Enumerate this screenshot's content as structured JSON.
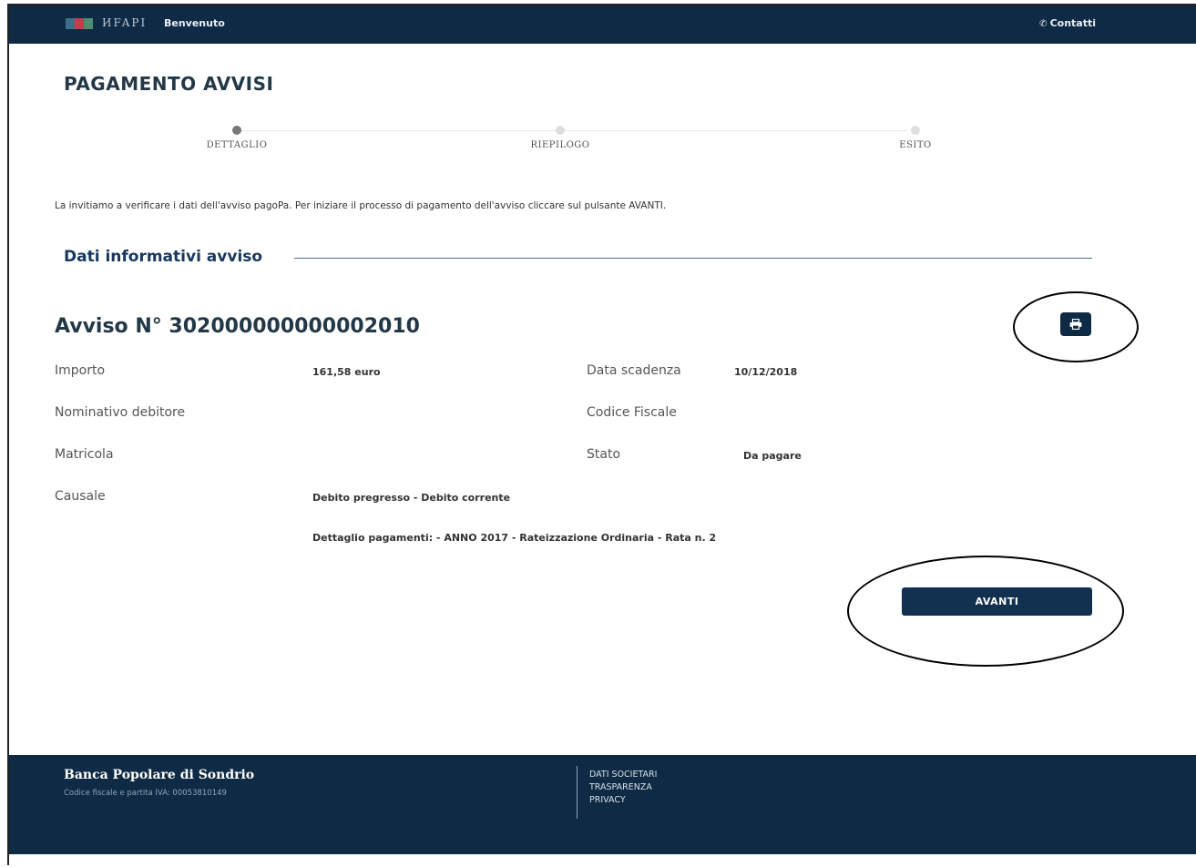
{
  "header": {
    "welcome": "Benvenuto",
    "contacts": "Contatti"
  },
  "page": {
    "title": "PAGAMENTO AVVISI"
  },
  "stepper": {
    "steps": [
      "DETTAGLIO",
      "RIEPILOGO",
      "ESITO"
    ],
    "active_index": 0
  },
  "intro": "La invitiamo a verificare i dati dell'avviso pagoPa. Per iniziare il processo di pagamento dell'avviso cliccare sul pulsante AVANTI.",
  "section": {
    "title": "Dati informativi avviso"
  },
  "notice": {
    "title": "Avviso N° 302000000000002010",
    "importo_label": "Importo",
    "importo_value": "161,58 euro",
    "scadenza_label": "Data scadenza",
    "scadenza_value": "10/12/2018",
    "nominativo_label": "Nominativo debitore",
    "codice_fiscale_label": "Codice Fiscale",
    "matricola_label": "Matricola",
    "stato_label": "Stato",
    "stato_value": "Da pagare",
    "causale_label": "Causale",
    "causale_value_1": "Debito pregresso - Debito corrente",
    "causale_value_2": "Dettaglio pagamenti: - ANNO 2017 - Rateizzazione Ordinaria - Rata n. 2"
  },
  "actions": {
    "next": "AVANTI"
  },
  "footer": {
    "bank_name": "Banca Popolare di Sondrio",
    "tax_info": "Codice fiscale e partita IVA: 00053810149",
    "links": [
      "DATI SOCIETARI",
      "TRASPARENZA",
      "PRIVACY"
    ]
  },
  "colors": {
    "header_bg": "#0f2a44",
    "button_bg": "#12304f",
    "section_title": "#17375e"
  }
}
